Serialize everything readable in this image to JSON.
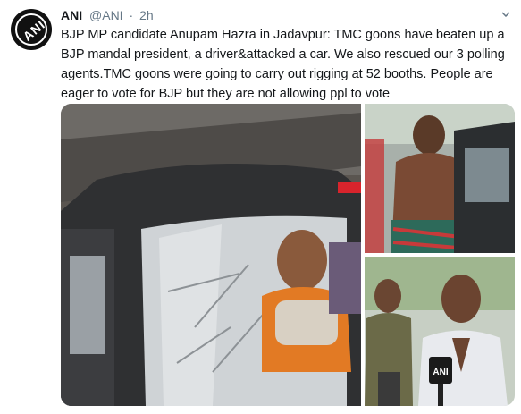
{
  "tweet": {
    "author_name": "ANI",
    "handle": "@ANI",
    "separator": "·",
    "time": "2h",
    "text": "BJP MP candidate Anupam Hazra in Jadavpur: TMC goons have beaten up a BJP mandal president, a driver&attacked a car. We also rescued our 3 polling agents.TMC goons were going to carry out rigging at 52 booths. People are eager to vote for BJP but they are not allowing ppl to vote"
  },
  "avatar": {
    "logo_text": "ANI",
    "icon": "ani-logo-icon"
  },
  "menu": {
    "icon": "chevron-down-icon"
  },
  "media": {
    "photos": [
      {
        "name": "photo-damaged-car"
      },
      {
        "name": "photo-injured-man"
      },
      {
        "name": "photo-man-speaking"
      }
    ],
    "mic_flag_text": "ANI"
  },
  "colors": {
    "secondary_text": "#657786",
    "primary_text": "#14171a"
  }
}
